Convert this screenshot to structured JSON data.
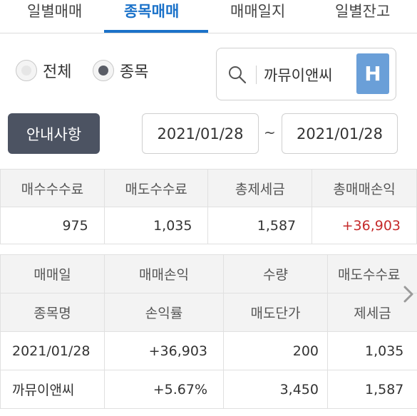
{
  "tabs": [
    "일별매매",
    "종목매매",
    "매매일지",
    "일별잔고"
  ],
  "active_tab": 1,
  "filter": {
    "options": [
      "전체",
      "종목"
    ],
    "selected": "종목",
    "search_value": "까뮤이앤씨",
    "search_button": "H"
  },
  "notice_button": "안내사항",
  "date_range": {
    "from": "2021/01/28",
    "separator": "~",
    "to": "2021/01/28"
  },
  "summary": {
    "headers": [
      "매수수수료",
      "매도수수료",
      "총제세금",
      "총매매손익"
    ],
    "values": [
      "975",
      "1,035",
      "1,587",
      "+36,903"
    ]
  },
  "detail": {
    "headers_row1": [
      "매매일",
      "매매손익",
      "수량",
      "매도수수료"
    ],
    "headers_row2": [
      "종목명",
      "손익률",
      "매도단가",
      "제세금"
    ],
    "row1": [
      "2021/01/28",
      "+36,903",
      "200",
      "1,035"
    ],
    "row2": [
      "까뮤이앤씨",
      "+5.67%",
      "3,450",
      "1,587"
    ]
  },
  "colors": {
    "accent": "#1b72c9",
    "profit": "#c52a2a",
    "notice_bg": "#4c5362",
    "h_button": "#6a9fd8"
  },
  "icons": {
    "search": "search-icon",
    "scroll_right": "chevron-right-icon"
  }
}
